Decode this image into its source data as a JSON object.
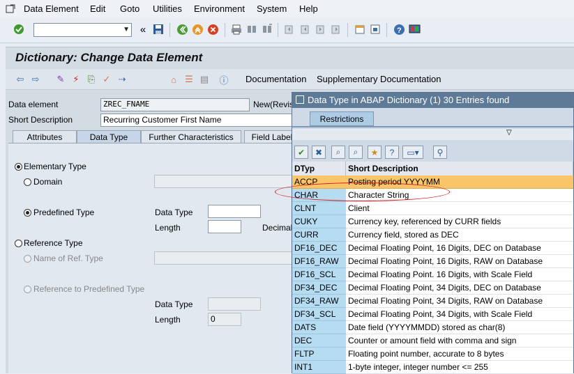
{
  "menubar": {
    "items": [
      "Data Element",
      "Edit",
      "Goto",
      "Utilities",
      "Environment",
      "System",
      "Help"
    ]
  },
  "toolbar": {
    "command_field_value": "",
    "icons": [
      "enter-icon",
      "back-icon",
      "save-icon",
      "back-nav-icon",
      "exit-icon",
      "cancel-icon",
      "print-icon",
      "find-icon",
      "find-next-icon",
      "first-page-icon",
      "prev-page-icon",
      "next-page-icon",
      "last-page-icon",
      "new-session-icon",
      "shortcut-icon",
      "help-icon",
      "layout-icon"
    ]
  },
  "title": "Dictionary: Change Data Element",
  "app_toolbar": {
    "documentation": "Documentation",
    "supplementary_documentation": "Supplementary Documentation"
  },
  "header_fields": {
    "data_element_label": "Data element",
    "data_element_value": "ZREC_FNAME",
    "status_text": "New(Revis",
    "short_description_label": "Short Description",
    "short_description_value": "Recurring Customer First Name"
  },
  "tabs": [
    "Attributes",
    "Data Type",
    "Further Characteristics",
    "Field Label"
  ],
  "active_tab": "Data Type",
  "data_type_tab": {
    "elementary_type": "Elementary Type",
    "domain": "Domain",
    "predefined_type": "Predefined Type",
    "data_type_label": "Data Type",
    "length_label": "Length",
    "decimal_label": "Decimal",
    "reference_type": "Reference Type",
    "name_of_ref_type": "Name of Ref. Type",
    "reference_to_predefined": "Reference to Predefined Type",
    "ref_data_type_label": "Data Type",
    "ref_length_label": "Length",
    "ref_length_value": "0"
  },
  "popup": {
    "title": "Data Type in ABAP Dictionary (1)   30 Entries found",
    "restrictions_tab": "Restrictions",
    "columns": [
      "DTyp",
      "Short Description"
    ],
    "selected_row": 0,
    "highlight_color": "#d31e1e",
    "rows": [
      [
        "ACCP",
        "Posting period YYYYMM"
      ],
      [
        "CHAR",
        "Character String"
      ],
      [
        "CLNT",
        "Client"
      ],
      [
        "CUKY",
        "Currency key, referenced by CURR fields"
      ],
      [
        "CURR",
        "Currency field, stored as DEC"
      ],
      [
        "DF16_DEC",
        "Decimal Floating Point, 16 Digits, DEC on Database"
      ],
      [
        "DF16_RAW",
        "Decimal Floating Point, 16 Digits,  RAW on Database"
      ],
      [
        "DF16_SCL",
        "Decimal Floating Point. 16 Digits, with Scale Field"
      ],
      [
        "DF34_DEC",
        "Decimal Floating Point, 34 Digits, DEC on Database"
      ],
      [
        "DF34_RAW",
        "Decimal Floating Point, 34 Digits, RAW on Database"
      ],
      [
        "DF34_SCL",
        "Decimal Floating Point, 34 Digits, with Scale Field"
      ],
      [
        "DATS",
        "Date field (YYYYMMDD) stored as char(8)"
      ],
      [
        "DEC",
        "Counter or amount field with comma and sign"
      ],
      [
        "FLTP",
        "Floating point number, accurate to 8 bytes"
      ],
      [
        "INT1",
        "1-byte integer, integer number <= 255"
      ]
    ]
  }
}
